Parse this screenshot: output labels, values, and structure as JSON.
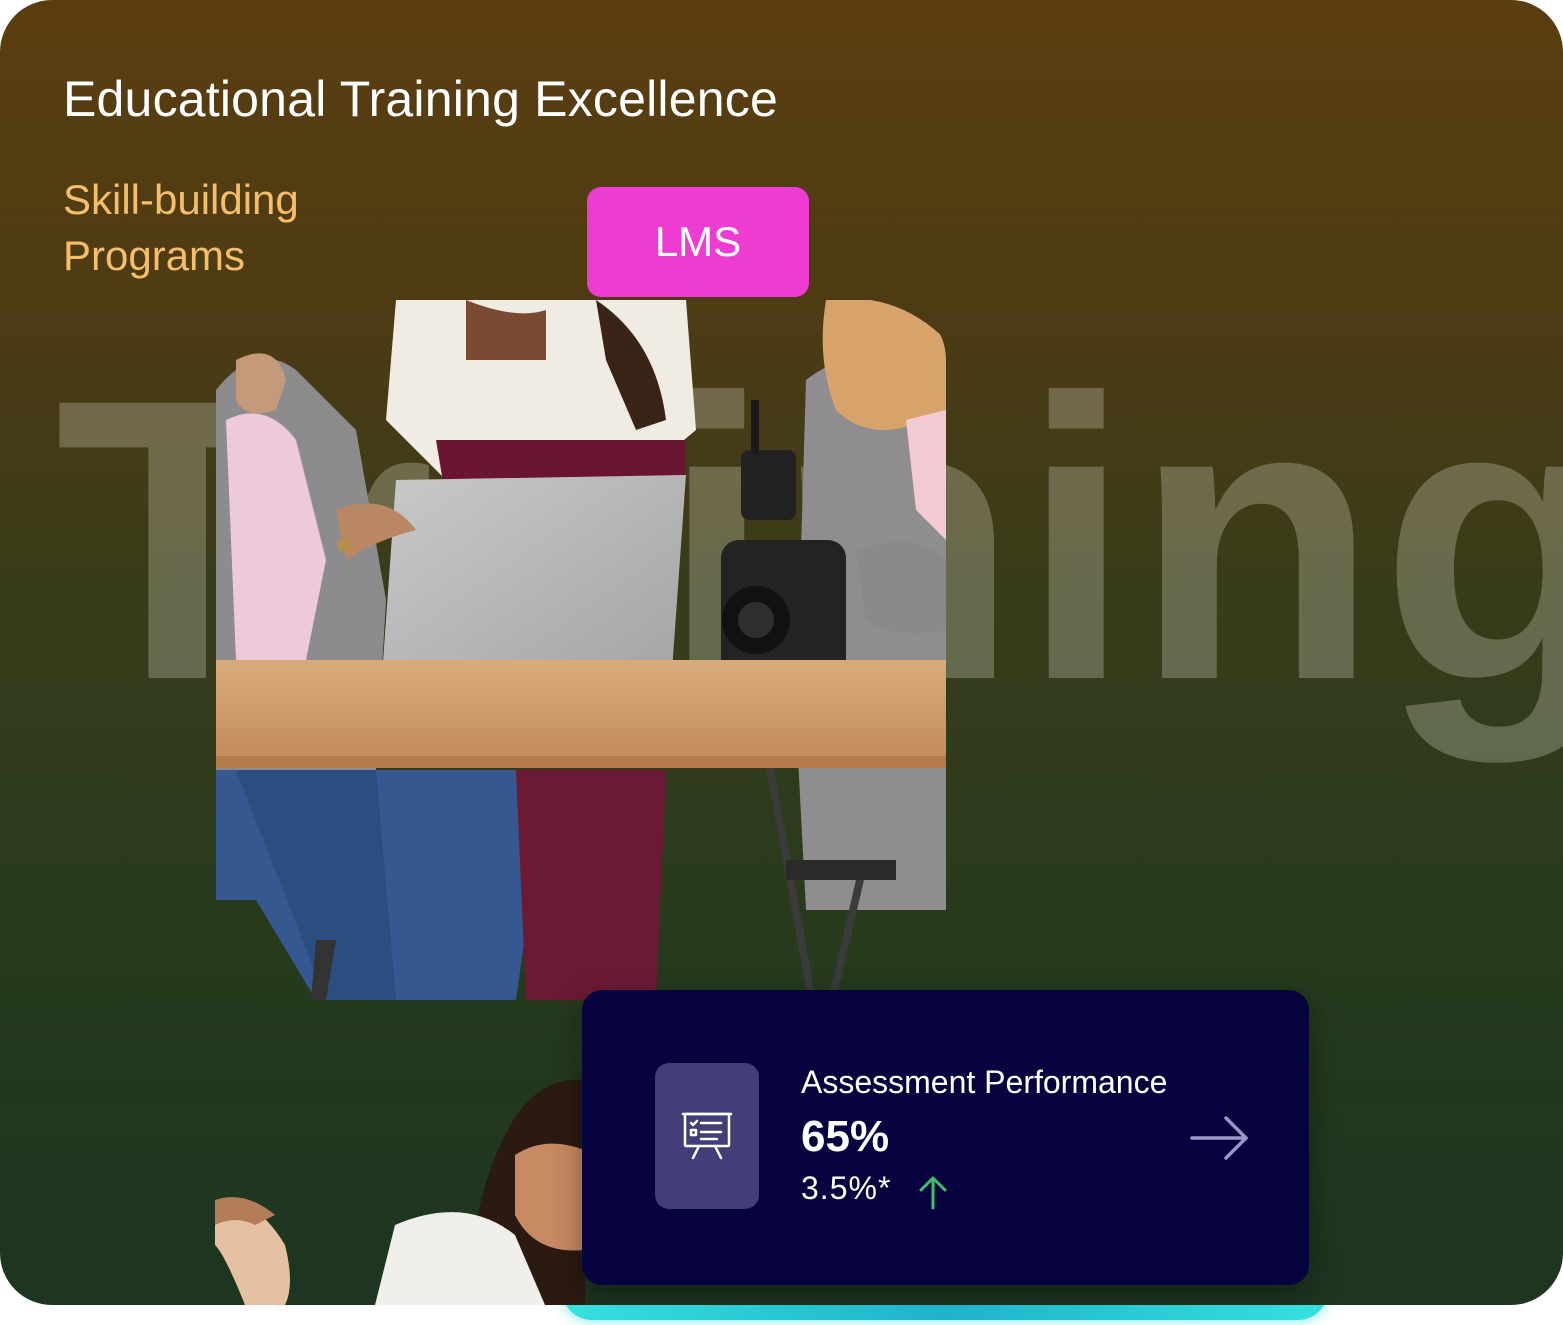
{
  "header": {
    "title": "Educational Training Excellence",
    "subtitle": "Skill-building Programs"
  },
  "watermark": "Training",
  "badge": {
    "label": "LMS",
    "color": "#ee3bd1"
  },
  "metric_card": {
    "label": "Assessment Performance",
    "value": "65%",
    "change": "3.5%*",
    "trend_icon": "arrow-up-icon",
    "trend_color": "#3fbf6e",
    "icon": "presentation-board-icon",
    "action_icon": "arrow-right-icon"
  },
  "images": {
    "main": "team-meeting-with-laptop-photo",
    "secondary": "smiling-woman-photo"
  },
  "colors": {
    "title": "#ffffff",
    "subtitle": "#f6bd6a",
    "card_background": "#06033f",
    "accent_glow": "#36e0e0"
  }
}
